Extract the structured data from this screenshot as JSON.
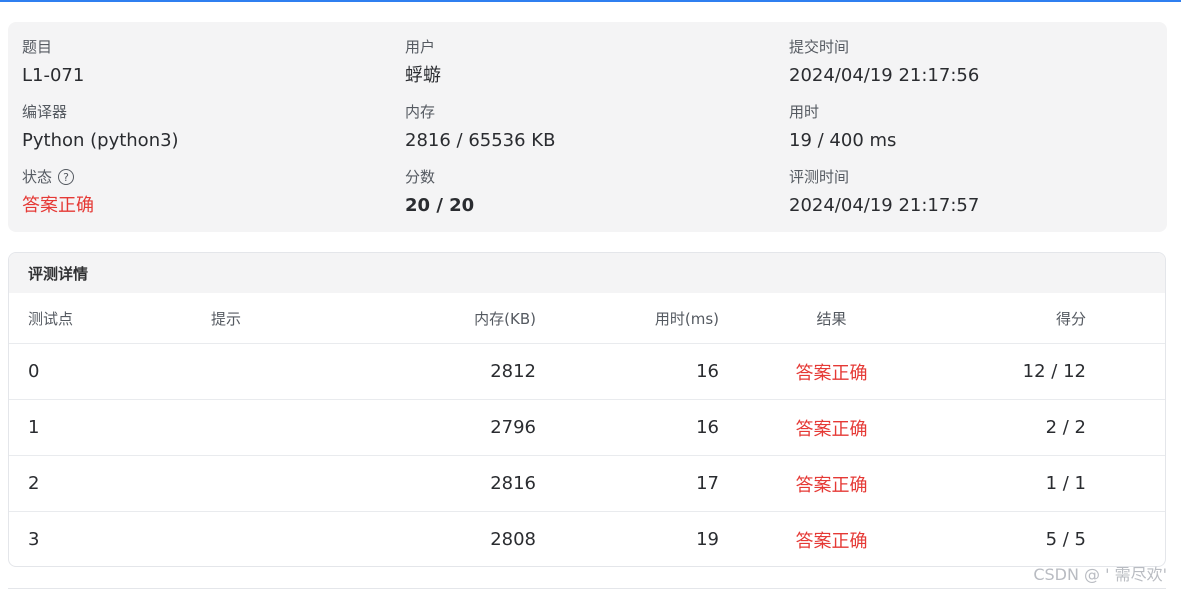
{
  "info": {
    "problem": {
      "label": "题目",
      "value": "L1-071"
    },
    "user": {
      "label": "用户",
      "value": "蜉蝣"
    },
    "submit_time": {
      "label": "提交时间",
      "value": "2024/04/19 21:17:56"
    },
    "compiler": {
      "label": "编译器",
      "value": "Python (python3)"
    },
    "memory": {
      "label": "内存",
      "value": "2816 / 65536 KB"
    },
    "time_used": {
      "label": "用时",
      "value": "19 / 400 ms"
    },
    "status": {
      "label": "状态",
      "value": "答案正确",
      "help_icon_glyph": "?"
    },
    "score": {
      "label": "分数",
      "value": "20 / 20"
    },
    "judge_time": {
      "label": "评测时间",
      "value": "2024/04/19 21:17:57"
    }
  },
  "detail": {
    "title": "评测详情",
    "columns": {
      "id": "测试点",
      "hint": "提示",
      "memory": "内存(KB)",
      "time": "用时(ms)",
      "result": "结果",
      "score": "得分"
    },
    "rows": [
      {
        "id": "0",
        "hint": "",
        "memory": "2812",
        "time": "16",
        "result": "答案正确",
        "score": "12 / 12"
      },
      {
        "id": "1",
        "hint": "",
        "memory": "2796",
        "time": "16",
        "result": "答案正确",
        "score": "2 / 2"
      },
      {
        "id": "2",
        "hint": "",
        "memory": "2816",
        "time": "17",
        "result": "答案正确",
        "score": "1 / 1"
      },
      {
        "id": "3",
        "hint": "",
        "memory": "2808",
        "time": "19",
        "result": "答案正确",
        "score": "5 / 5"
      }
    ]
  },
  "watermark": "CSDN @ ' 需尽欢'",
  "colors": {
    "accent": "#2f7ff0",
    "success_text": "#e53935",
    "card_bg": "#f4f4f5"
  }
}
